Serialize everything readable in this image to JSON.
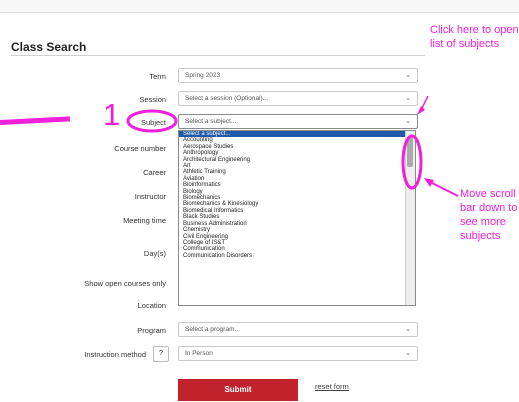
{
  "page": {
    "title": "Class Search"
  },
  "form": {
    "term": {
      "label": "Term",
      "value": "Spring 2023"
    },
    "session": {
      "label": "Session",
      "placeholder": "Select a session (Optional)..."
    },
    "subject": {
      "label": "Subject",
      "placeholder": "Select a subject..."
    },
    "course_number": {
      "label": "Course number"
    },
    "career": {
      "label": "Career"
    },
    "instructor": {
      "label": "Instructor"
    },
    "meeting_time": {
      "label": "Meeting time"
    },
    "days": {
      "label": "Day(s)"
    },
    "open_courses": {
      "label": "Show open courses only"
    },
    "location": {
      "label": "Location"
    },
    "program": {
      "label": "Program",
      "placeholder": "Select a program..."
    },
    "instruction_method": {
      "label": "Instruction method",
      "help": "?",
      "value": "In Person"
    },
    "submit_label": "Submit",
    "reset_label": "reset form"
  },
  "subject_list": {
    "selected": "Select a subject...",
    "options": [
      "Accounting",
      "Aerospace Studies",
      "Anthropology",
      "Architectural Engineering",
      "Art",
      "Athletic Training",
      "Aviation",
      "Bioinformatics",
      "Biology",
      "Biomechanics",
      "Biomechanics & Kinesiology",
      "Biomedical Informatics",
      "Black Studies",
      "Business Administration",
      "Chemistry",
      "Civil Engineering",
      "College of IS&T",
      "Communication",
      "Communication Disorders"
    ]
  },
  "annotations": {
    "step_number": "1",
    "click_note": "Click here to open list of subjects",
    "scroll_note": "Move scroll bar down to see more subjects",
    "color": "#f021d8"
  }
}
